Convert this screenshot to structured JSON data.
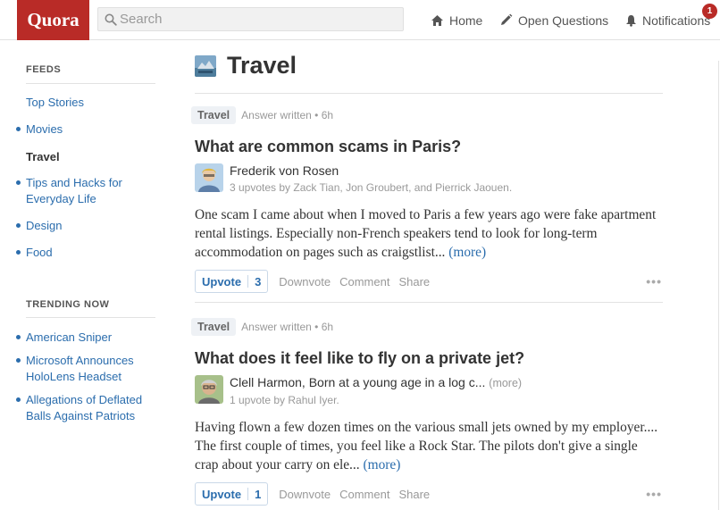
{
  "header": {
    "logo": "Quora",
    "search_placeholder": "Search",
    "nav": {
      "home": "Home",
      "open_questions": "Open Questions",
      "notifications": "Notifications",
      "notifications_count": "1"
    }
  },
  "sidebar": {
    "feeds_heading": "FEEDS",
    "feeds": [
      {
        "label": "Top Stories"
      },
      {
        "label": "Movies"
      },
      {
        "label": "Travel"
      },
      {
        "label": "Tips and Hacks for Everyday Life"
      },
      {
        "label": "Design"
      },
      {
        "label": "Food"
      }
    ],
    "trending_heading": "TRENDING NOW",
    "trending": [
      {
        "label": "American Sniper"
      },
      {
        "label": "Microsoft Announces HoloLens Headset"
      },
      {
        "label": "Allegations of Deflated Balls Against Patriots"
      }
    ]
  },
  "feed": {
    "title": "Travel",
    "stories": [
      {
        "topic": "Travel",
        "meta": "Answer written • 6h",
        "question": "What are common scams in Paris?",
        "author": "Frederik von Rosen",
        "author_more": "",
        "upvoters": "3 upvotes by Zack Tian, Jon Groubert, and Pierrick Jaouen.",
        "answer": "One scam I came about when I moved to Paris a few years ago were fake apartment rental listings. Especially non-French speakers tend to look for long-term accommodation on pages such as craigstlist...",
        "more": "(more)",
        "upvote_label": "Upvote",
        "upvote_count": "3",
        "downvote": "Downvote",
        "comment": "Comment",
        "share": "Share"
      },
      {
        "topic": "Travel",
        "meta": "Answer written • 6h",
        "question": "What does it feel like to fly on a private jet?",
        "author": "Clell Harmon, Born at a young age in a log c...",
        "author_more": "(more)",
        "upvoters": "1 upvote by Rahul Iyer.",
        "answer": "Having flown a few dozen times on the various small jets owned by my employer.... The first couple of times, you feel like a Rock Star.  The pilots don't give a single crap about your carry on ele...",
        "more": "(more)",
        "upvote_label": "Upvote",
        "upvote_count": "1",
        "downvote": "Downvote",
        "comment": "Comment",
        "share": "Share"
      }
    ]
  },
  "colors": {
    "brand": "#b92b27",
    "link": "#2b6dad",
    "muted": "#999999"
  }
}
